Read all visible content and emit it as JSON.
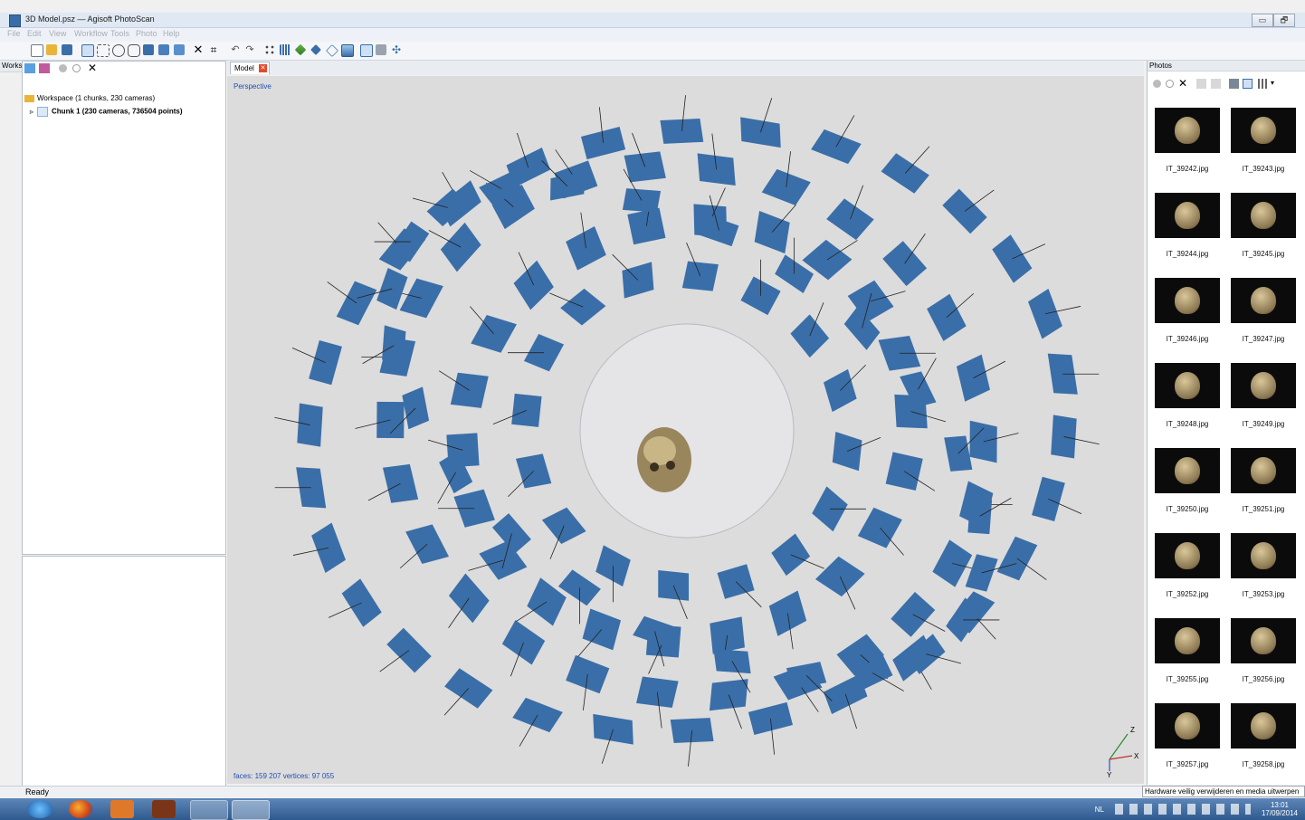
{
  "window": {
    "title": "3D Model.psz — Agisoft PhotoScan",
    "minimize": "▭",
    "maximize": "🗗"
  },
  "menu": [
    "File",
    "Edit",
    "View",
    "Workflow",
    "Tools",
    "Photo",
    "Help"
  ],
  "workspace": {
    "title": "Workspace",
    "root_label": "Workspace (1 chunks, 230 cameras)",
    "chunk_label": "Chunk 1 (230 cameras, 736504 points)"
  },
  "viewport": {
    "tab_label": "Model",
    "projection": "Perspective",
    "stats": "faces: 159 207 vertices: 97 055",
    "axes": {
      "z": "Z",
      "x": "X",
      "y": "Y"
    }
  },
  "photos": {
    "title": "Photos",
    "items": [
      "IT_39242.jpg",
      "IT_39243.jpg",
      "IT_39244.jpg",
      "IT_39245.jpg",
      "IT_39246.jpg",
      "IT_39247.jpg",
      "IT_39248.jpg",
      "IT_39249.jpg",
      "IT_39250.jpg",
      "IT_39251.jpg",
      "IT_39252.jpg",
      "IT_39253.jpg",
      "IT_39255.jpg",
      "IT_39256.jpg",
      "IT_39257.jpg",
      "IT_39258.jpg"
    ]
  },
  "status": {
    "text": "Ready",
    "tooltip": "Hardware veilig verwijderen en media uitwerpen"
  },
  "taskbar": {
    "language": "NL",
    "time": "13:01",
    "date": "17/09/2014"
  },
  "colors": {
    "camera_plane": "#3a6ea8",
    "viewport_bg": "#dcdcdc",
    "info_text": "#1f4fb5"
  }
}
